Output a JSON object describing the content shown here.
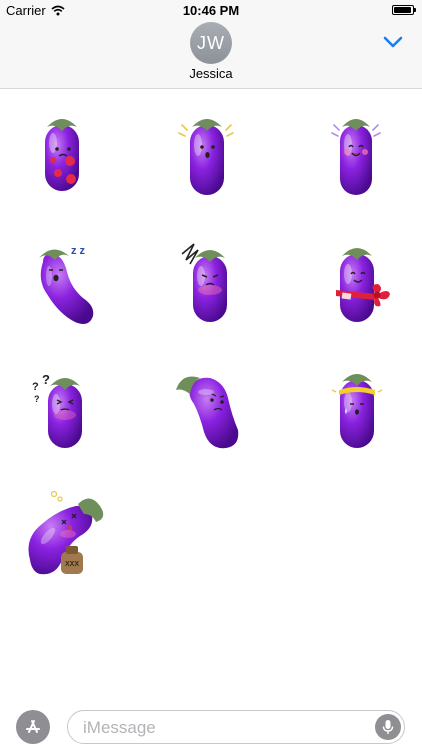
{
  "status_bar": {
    "carrier": "Carrier",
    "time": "10:46 PM",
    "battery_level": 0.95
  },
  "header": {
    "avatar_initials": "JW",
    "contact_name": "Jessica",
    "collapse_icon": "chevron-down-icon"
  },
  "stickers": [
    {
      "name": "eggplant-spotted",
      "expression": "sick with red spots"
    },
    {
      "name": "eggplant-surprised",
      "expression": "surprised with sparkle lines"
    },
    {
      "name": "eggplant-excited",
      "expression": "happy with purple sparkle lines"
    },
    {
      "name": "eggplant-sleepy",
      "expression": "yawning with zzz"
    },
    {
      "name": "eggplant-annoyed",
      "expression": "frowning with scribble"
    },
    {
      "name": "eggplant-gift",
      "expression": "smiling with red bow"
    },
    {
      "name": "eggplant-confused",
      "expression": "confused with question marks"
    },
    {
      "name": "eggplant-sad",
      "expression": "bent and sad"
    },
    {
      "name": "eggplant-sweaty",
      "expression": "headband and sweat"
    },
    {
      "name": "eggplant-drunk",
      "expression": "dizzy with xxx jug"
    }
  ],
  "jug_label": "XXX",
  "zzz_text": "z z",
  "question_text": "?",
  "composer": {
    "placeholder": "iMessage",
    "appstore_icon": "app-store-icon",
    "mic_icon": "microphone-icon"
  },
  "colors": {
    "accent": "#1b7cf3",
    "eggplant_purple": "#7a1ed0",
    "cap_green": "#6f8f5a"
  }
}
